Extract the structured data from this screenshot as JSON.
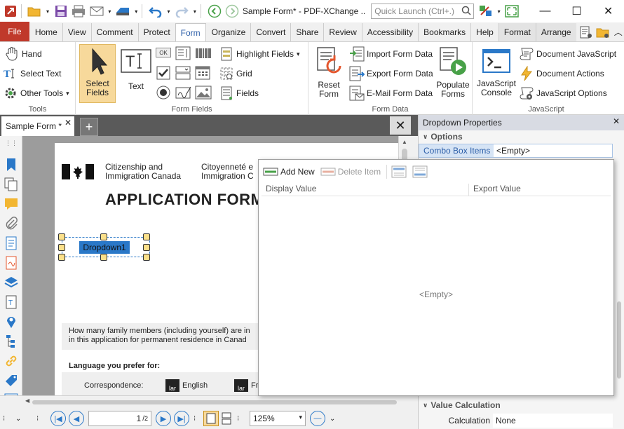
{
  "titlebar": {
    "title": "Sample Form* - PDF-XChange ..",
    "quick_launch_placeholder": "Quick Launch (Ctrl+.)"
  },
  "menu": {
    "file": "File",
    "tabs": [
      "Home",
      "View",
      "Comment",
      "Protect",
      "Form",
      "Organize",
      "Convert",
      "Share",
      "Review",
      "Accessibility",
      "Bookmarks",
      "Help",
      "Format",
      "Arrange"
    ],
    "active_tab": "Form"
  },
  "ribbon": {
    "tools": {
      "label": "Tools",
      "hand": "Hand",
      "select_text": "Select Text",
      "other_tools": "Other Tools"
    },
    "form_fields": {
      "label": "Form Fields",
      "select_fields": "Select\nFields",
      "text": "Text",
      "highlight_fields": "Highlight Fields",
      "grid": "Grid",
      "fields": "Fields",
      "ok": "OK"
    },
    "form_data": {
      "label": "Form Data",
      "reset_form": "Reset\nForm",
      "import": "Import Form Data",
      "export": "Export Form Data",
      "email": "E-Mail Form Data",
      "populate": "Populate\nForms"
    },
    "javascript": {
      "label": "JavaScript",
      "console": "JavaScript\nConsole",
      "doc_js": "Document JavaScript",
      "doc_actions": "Document Actions",
      "js_options": "JavaScript Options"
    }
  },
  "doc_tab": {
    "name": "Sample Form *"
  },
  "page": {
    "dept_en_1": "Citizenship and",
    "dept_en_2": "Immigration Canada",
    "dept_fr_1": "Citoyenneté e",
    "dept_fr_2": "Immigration C",
    "heading": "APPLICATION FORM",
    "dropdown_text": "Dropdown1",
    "family_q_1": "How many family members (including yourself) are in",
    "family_q_2": "in this application for permanent residence in Canad",
    "language_label": "Language you prefer for:",
    "correspondence": "Correspondence:",
    "english": "English",
    "french": "Fr",
    "lang_icon": "lar"
  },
  "nav": {
    "page_value": "1",
    "page_total": "2",
    "zoom": "125%"
  },
  "properties": {
    "title": "Dropdown Properties",
    "options_section": "Options",
    "combo_label": "Combo Box Items",
    "combo_value": "<Empty>",
    "value_calc_section": "Value Calculation",
    "calculation_label": "Calculation",
    "calculation_value": "None"
  },
  "popup": {
    "add_new": "Add New",
    "delete_item": "Delete Item",
    "col_display": "Display Value",
    "col_export": "Export Value",
    "empty": "<Empty>"
  }
}
